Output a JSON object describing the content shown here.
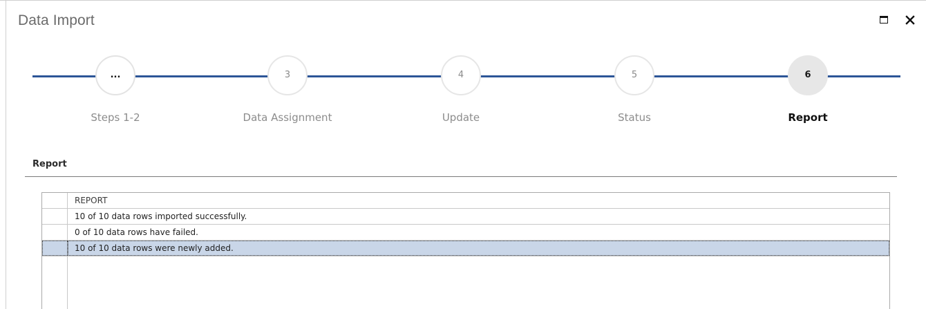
{
  "window": {
    "title": "Data Import"
  },
  "wizard": {
    "accent_color": "#2c5597",
    "steps": [
      {
        "number": "...",
        "label": "Steps 1-2",
        "active": false
      },
      {
        "number": "3",
        "label": "Data Assignment",
        "active": false
      },
      {
        "number": "4",
        "label": "Update",
        "active": false
      },
      {
        "number": "5",
        "label": "Status",
        "active": false
      },
      {
        "number": "6",
        "label": "Report",
        "active": true
      }
    ]
  },
  "section": {
    "title": "Report"
  },
  "grid": {
    "column_header": "REPORT",
    "rows": [
      {
        "text": "10 of 10 data rows imported successfully.",
        "selected": false
      },
      {
        "text": "0 of 10 data rows have failed.",
        "selected": false
      },
      {
        "text": "10 of 10 data rows were newly added.",
        "selected": true
      }
    ],
    "selection_color": "#c9d6e8"
  },
  "icons": {
    "maximize": "maximize-icon",
    "close": "close-icon"
  }
}
